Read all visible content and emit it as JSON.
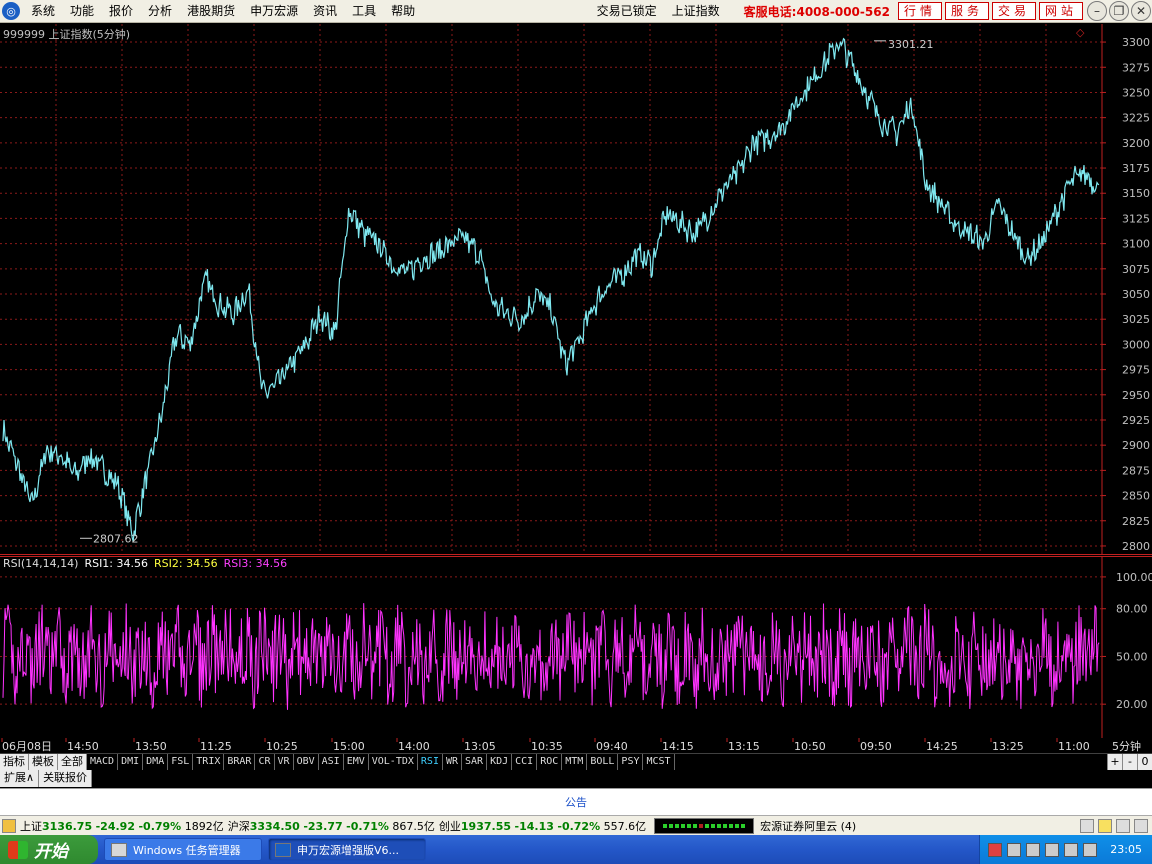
{
  "menu": {
    "items": [
      "系统",
      "功能",
      "报价",
      "分析",
      "港股期货",
      "申万宏源",
      "资讯",
      "工具",
      "帮助"
    ],
    "center": [
      "交易已锁定",
      "上证指数"
    ],
    "hotline": "客服电话:4008-000-562",
    "buttons": [
      "行情",
      "服务",
      "交易",
      "网站"
    ]
  },
  "chart": {
    "title": "999999 上证指数(5分钟)",
    "high_label": "3301.21",
    "low_label": "2807.62",
    "y_ticks": [
      "3300",
      "3275",
      "3250",
      "3225",
      "3200",
      "3175",
      "3150",
      "3125",
      "3100",
      "3075",
      "3050",
      "3025",
      "3000",
      "2975",
      "2950",
      "2925",
      "2900",
      "2875",
      "2850",
      "2825",
      "2800"
    ],
    "y_range": [
      2795,
      3308
    ],
    "colors": {
      "price": "#7fe8f0",
      "grid": "#8b1a1a",
      "axis": "#c02020",
      "rsi": "#ff33ff",
      "rsi_axis": "#c02020"
    }
  },
  "chart_data": [
    {
      "type": "line",
      "title": "999999 上证指数(5分钟)",
      "ylim": [
        2795,
        3308
      ],
      "xlabel": "",
      "ylabel": "",
      "grid": true,
      "x": [
        "06月08日",
        "14:50",
        "13:50",
        "11:25",
        "10:25",
        "15:00",
        "14:00",
        "13:05",
        "10:35",
        "09:40",
        "14:15",
        "13:15",
        "10:50",
        "09:50",
        "14:25",
        "13:25",
        "11:00"
      ],
      "series": [
        {
          "name": "",
          "values": [
            2915,
            2880,
            2840,
            2895,
            2890,
            2870,
            2890,
            2875,
            2860,
            2812,
            2870,
            2930,
            3010,
            3000,
            3065,
            3040,
            3030,
            3055,
            2950,
            2960,
            2980,
            3000,
            3030,
            3010,
            3135,
            3110,
            3100,
            3080,
            3070,
            3085,
            3090,
            3100,
            3105,
            3090,
            3040,
            3030,
            3025,
            3050,
            3035,
            2980,
            3005,
            3040,
            3060,
            3070,
            3090,
            3080,
            3130,
            3120,
            3110,
            3130,
            3155,
            3170,
            3200,
            3205,
            3215,
            3240,
            3260,
            3280,
            3300,
            3275,
            3245,
            3220,
            3210,
            3240,
            3160,
            3140,
            3120,
            3110,
            3100,
            3140,
            3110,
            3085,
            3100,
            3130,
            3160,
            3170,
            3155
          ]
        }
      ]
    },
    {
      "type": "line",
      "title": "RSI(14,14,14)",
      "ylim": [
        0,
        110
      ],
      "y_ticks": [
        100.0,
        80.0,
        50.0,
        20.0
      ],
      "series": [
        {
          "name": "RSI1",
          "values": [
            34.56
          ]
        },
        {
          "name": "RSI2",
          "values": [
            34.56
          ]
        },
        {
          "name": "RSI3",
          "values": [
            34.56
          ]
        }
      ]
    }
  ],
  "rsi": {
    "label": "RSI(14,14,14)",
    "rsi1": "RSI1: 34.56",
    "rsi2": "RSI2: 34.56",
    "rsi3": "RSI3: 34.56",
    "y_ticks": [
      "100.00",
      "80.00",
      "50.00",
      "20.00"
    ]
  },
  "time_axis": [
    "06月08日",
    "14:50",
    "13:50",
    "11:25",
    "10:25",
    "15:00",
    "14:00",
    "13:05",
    "10:35",
    "09:40",
    "14:15",
    "13:15",
    "10:50",
    "09:50",
    "14:25",
    "13:25",
    "11:00"
  ],
  "period": "5分钟",
  "tabs": {
    "left": [
      "指标",
      "模板",
      "全部"
    ],
    "indicators": [
      "MACD",
      "DMI",
      "DMA",
      "FSL",
      "TRIX",
      "BRAR",
      "CR",
      "VR",
      "OBV",
      "ASI",
      "EMV",
      "VOL-TDX",
      "RSI",
      "WR",
      "SAR",
      "KDJ",
      "CCI",
      "ROC",
      "MTM",
      "BOLL",
      "PSY",
      "MCST"
    ],
    "active": "RSI",
    "controls": [
      "+",
      "-",
      "0"
    ]
  },
  "expand": [
    "扩展∧",
    "关联报价"
  ],
  "notice": "公告",
  "status": {
    "indices": [
      {
        "name": "上证",
        "value": "3136.75",
        "chg": "-24.92",
        "pct": "-0.79%",
        "amt": "1892亿"
      },
      {
        "name": "沪深",
        "value": "3334.50",
        "chg": "-23.77",
        "pct": "-0.71%",
        "amt": "867.5亿"
      },
      {
        "name": "创业",
        "value": "1937.55",
        "chg": "-14.13",
        "pct": "-0.72%",
        "amt": "557.6亿"
      }
    ],
    "server": "宏源证券阿里云 (4)"
  },
  "taskbar": {
    "start": "开始",
    "tasks": [
      "Windows 任务管理器",
      "申万宏源增强版V6..."
    ],
    "clock": "23:05"
  }
}
